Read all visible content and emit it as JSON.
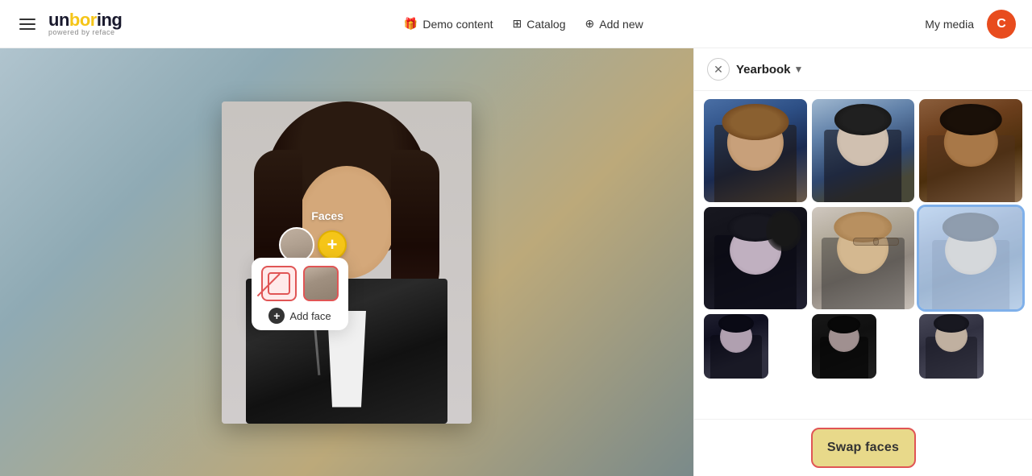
{
  "header": {
    "menu_icon": "hamburger-icon",
    "logo_main": "unboring",
    "logo_sub": "powered by reface",
    "nav": [
      {
        "label": "Demo content",
        "icon": "gift-icon"
      },
      {
        "label": "Catalog",
        "icon": "grid-icon"
      },
      {
        "label": "Add new",
        "icon": "plus-icon"
      }
    ],
    "my_media_label": "My media",
    "avatar_letter": "C"
  },
  "left_panel": {
    "faces_label": "Faces"
  },
  "tooltip": {
    "add_face_label": "Add face"
  },
  "right_panel": {
    "close_icon": "close-icon",
    "category_label": "Yearbook",
    "chevron_icon": "chevron-down-icon",
    "photos": [
      {
        "id": "p1",
        "style": "p1",
        "selected": false
      },
      {
        "id": "p2",
        "style": "p2",
        "selected": false
      },
      {
        "id": "p3",
        "style": "p3",
        "selected": false
      },
      {
        "id": "p4",
        "style": "p4",
        "selected": false
      },
      {
        "id": "p5",
        "style": "p5",
        "selected": false
      },
      {
        "id": "p6",
        "style": "p6",
        "selected": true
      },
      {
        "id": "p7",
        "style": "p7",
        "selected": false
      },
      {
        "id": "p8",
        "style": "p8",
        "selected": false
      },
      {
        "id": "p9",
        "style": "p4",
        "selected": false
      }
    ],
    "swap_button_label": "Swap faces"
  },
  "colors": {
    "accent_yellow": "#f5c518",
    "accent_red": "#e05555",
    "swap_bg": "#e8d98a",
    "selected_blue": "#4a90e2"
  }
}
